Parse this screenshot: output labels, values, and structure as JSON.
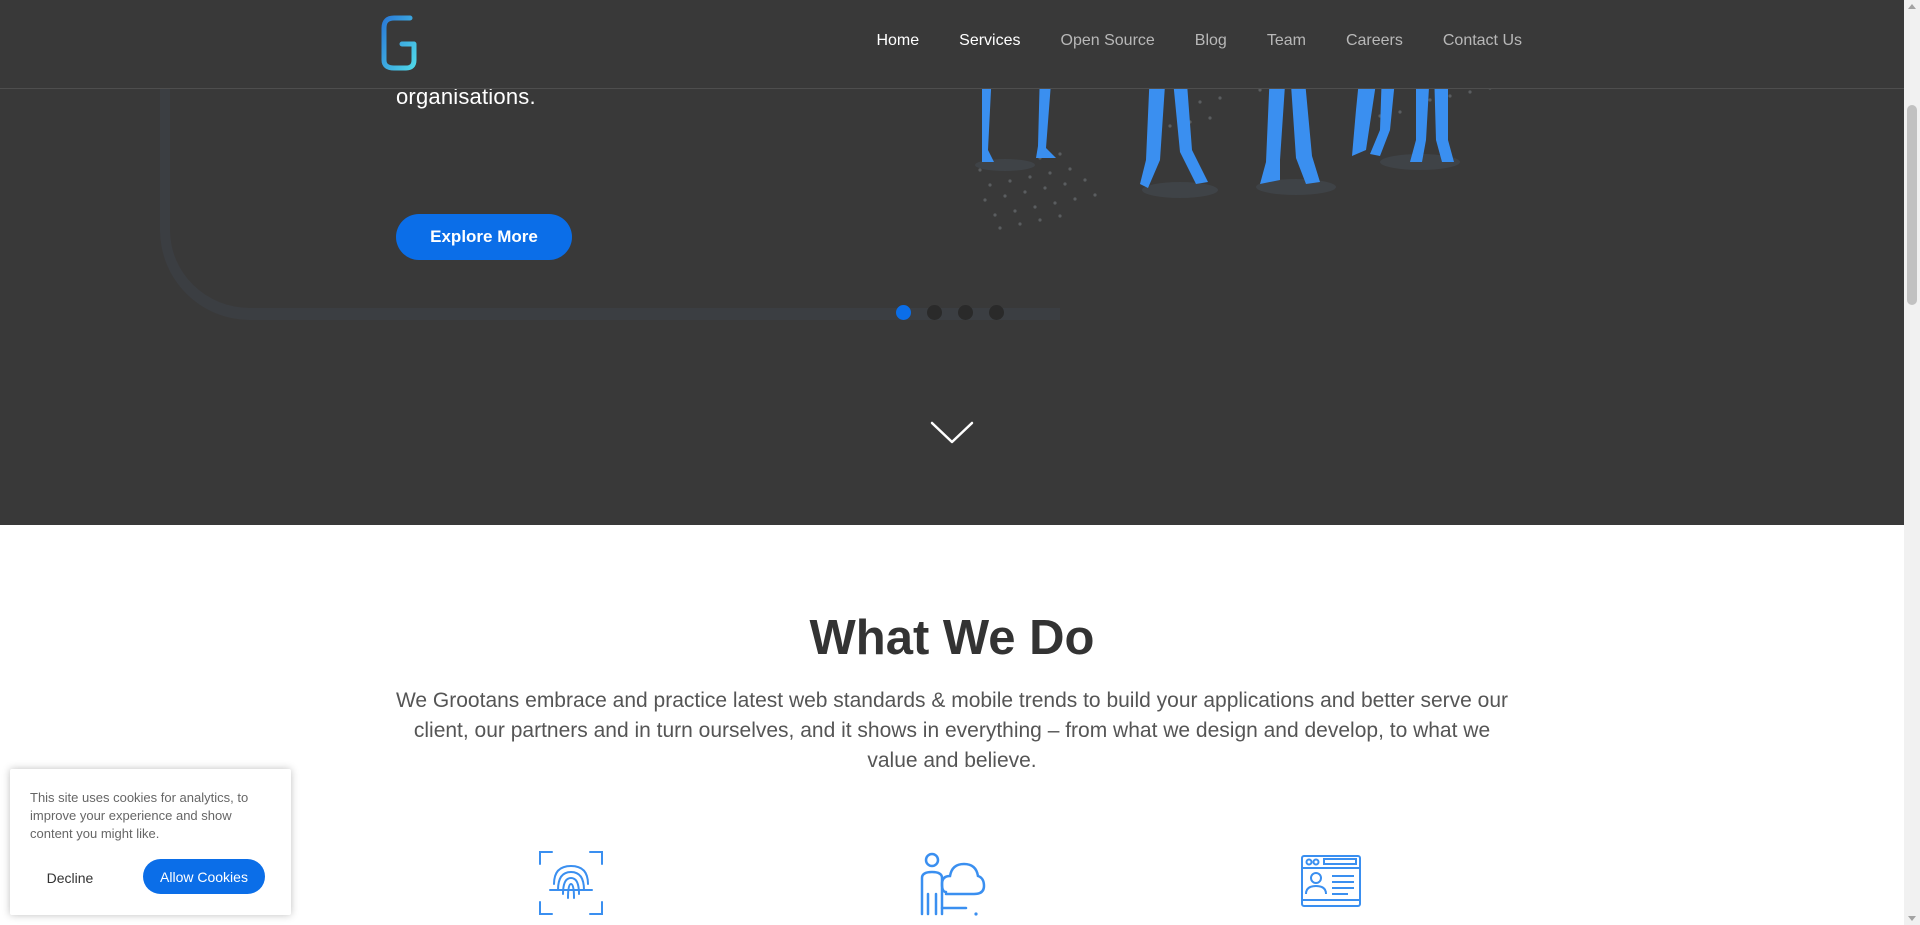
{
  "nav": {
    "items": [
      {
        "label": "Home"
      },
      {
        "label": "Services"
      },
      {
        "label": "Open Source"
      },
      {
        "label": "Blog"
      },
      {
        "label": "Team"
      },
      {
        "label": "Careers"
      },
      {
        "label": "Contact Us"
      }
    ],
    "active": [
      "Home",
      "Services"
    ]
  },
  "hero": {
    "subtitle_fragment": "organisations.",
    "cta_label": "Explore More",
    "carousel_slides": 4,
    "carousel_active": 1
  },
  "what_we_do": {
    "title": "What We Do",
    "description": "We Grootans embrace and practice latest web standards & mobile trends to build your applications and better serve our client, our partners and in turn ourselves, and it shows in everything – from what we design and develop, to what we value and believe.",
    "icons": [
      "fingerprint-icon",
      "person-cloud-icon",
      "profile-card-icon"
    ]
  },
  "cookie": {
    "message": "This site uses cookies for analytics, to improve your experience and show content you might like.",
    "decline_label": "Decline",
    "allow_label": "Allow Cookies"
  },
  "colors": {
    "hero_bg": "#393939",
    "accent": "#0b6ee8",
    "illustration_blue": "#3a8ff0"
  }
}
